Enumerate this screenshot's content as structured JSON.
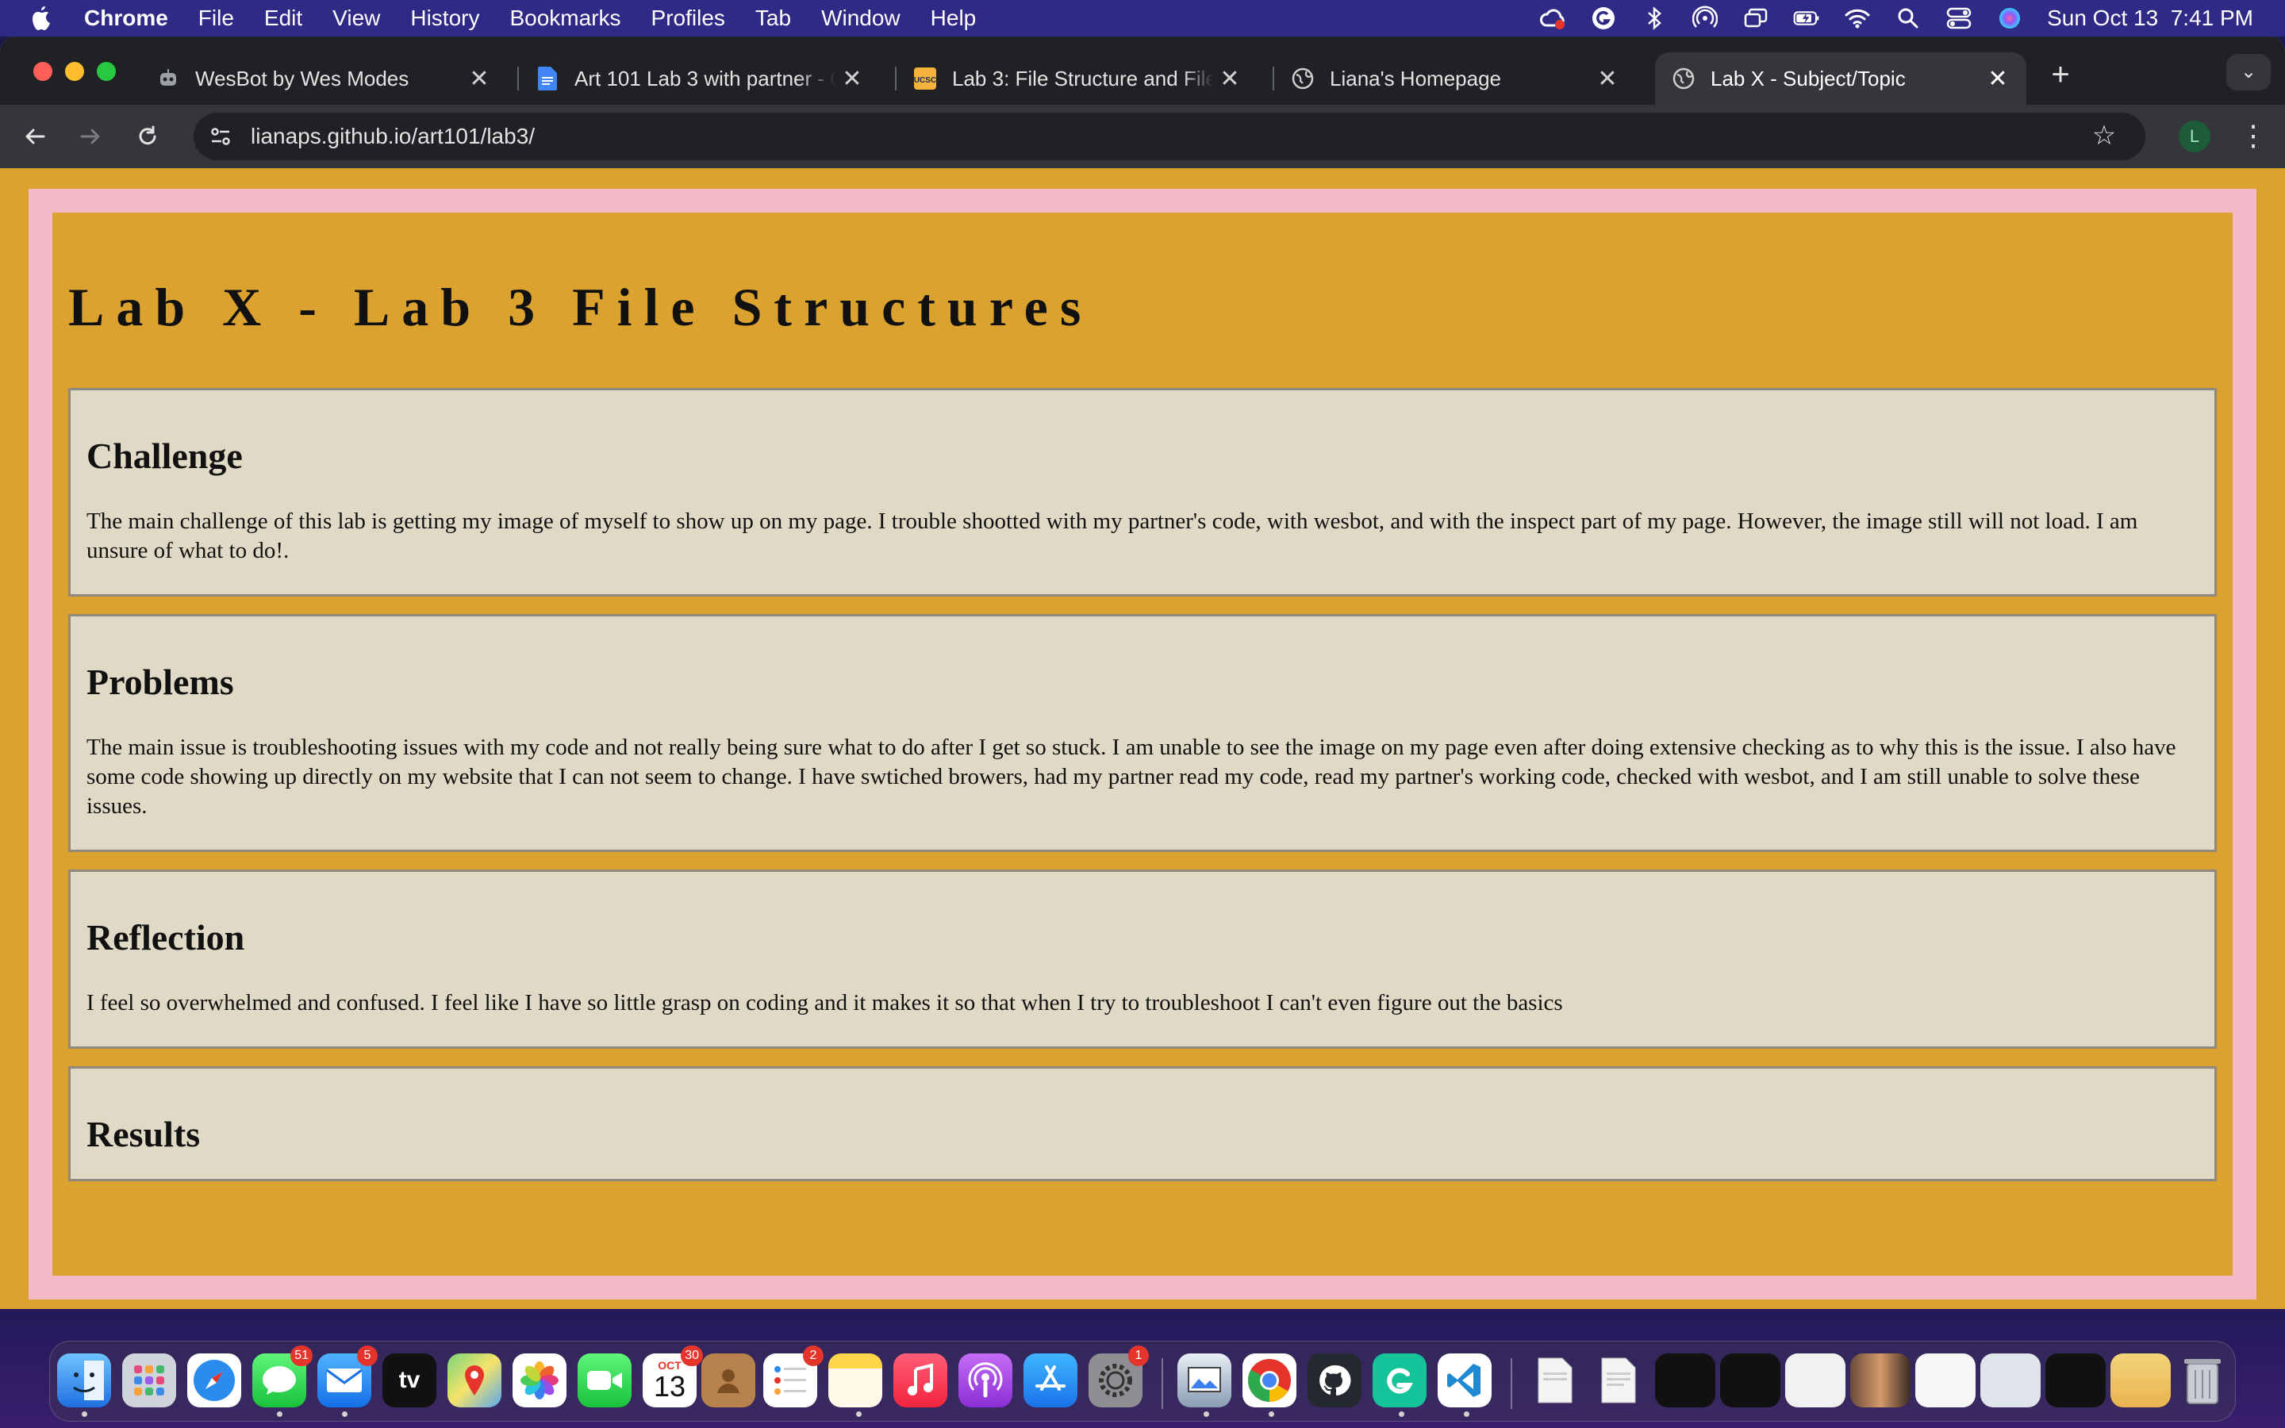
{
  "menubar": {
    "app_name": "Chrome",
    "items": [
      "File",
      "Edit",
      "View",
      "History",
      "Bookmarks",
      "Profiles",
      "Tab",
      "Window",
      "Help"
    ],
    "clock": "Sun Oct 13  7:41 PM"
  },
  "tabs": [
    {
      "title": "WesBot by Wes Modes",
      "icon": "robot-icon",
      "active": false
    },
    {
      "title": "Art 101 Lab 3 with partner - G",
      "icon": "google-docs-icon",
      "active": false
    },
    {
      "title": "Lab 3: File Structure and File",
      "icon": "ucsc-icon",
      "active": false
    },
    {
      "title": "Liana's Homepage",
      "icon": "globe-icon",
      "active": false
    },
    {
      "title": "Lab X - Subject/Topic",
      "icon": "globe-icon",
      "active": true
    }
  ],
  "toolbar": {
    "url": "lianaps.github.io/art101/lab3/",
    "profile_initial": "L"
  },
  "page": {
    "title": "Lab X - Lab 3 File Structures",
    "sections": [
      {
        "heading": "Challenge",
        "body": "The main challenge of this lab is getting my image of myself to show up on my page. I trouble shootted with my partner's code, with wesbot, and with the inspect part of my page. However, the image still will not load. I am unsure of what to do!."
      },
      {
        "heading": "Problems",
        "body": "The main issue is troubleshooting issues with my code and not really being sure what to do after I get so stuck. I am unable to see the image on my page even after doing extensive checking as to why this is the issue. I also have some code showing up directly on my website that I can not seem to change. I have swtiched browers, had my partner read my code, read my partner's working code, checked with wesbot, and I am still unable to solve these issues."
      },
      {
        "heading": "Reflection",
        "body": "I feel so overwhelmed and confused. I feel like I have so little grasp on coding and it makes it so that when I try to troubleshoot I can't even figure out the basics"
      },
      {
        "heading": "Results",
        "body": ""
      }
    ]
  },
  "dock": {
    "badges": {
      "messages": "51",
      "mail": "5",
      "reminders": "2",
      "settings": "1",
      "calendar_month": "OCT",
      "calendar_day": "13",
      "calendar_badge": "30"
    },
    "tv_label": "tv"
  },
  "colors": {
    "page_bg": "#dca22f",
    "frame_pink": "#f4b9c6",
    "section_bg": "#e0d9c5",
    "menubar_bg": "#2e2a86",
    "tabstrip_bg": "#202124",
    "toolbar_bg": "#35363a"
  }
}
